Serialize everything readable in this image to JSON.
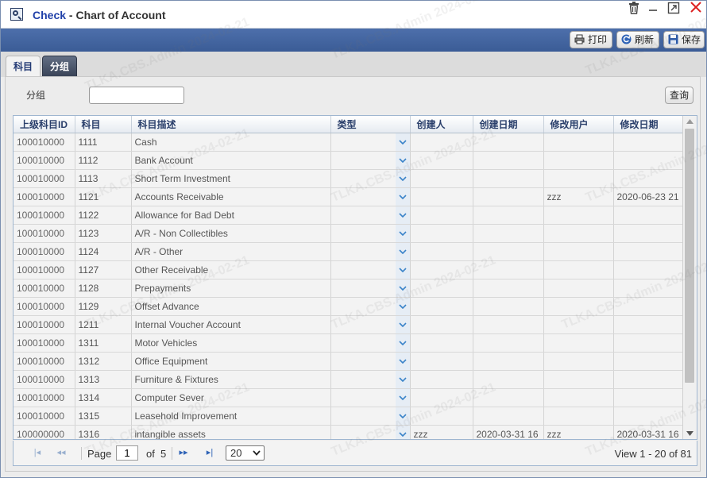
{
  "window": {
    "title_prefix": "Check",
    "title_sep": " - ",
    "title_main": "Chart of Account",
    "buttons": [
      "trash",
      "minimize",
      "maximize",
      "close"
    ]
  },
  "toolbar": {
    "print_label": "打印",
    "refresh_label": "刷新",
    "save_label": "保存"
  },
  "tabs": [
    {
      "label": "科目",
      "active": true
    },
    {
      "label": "分组",
      "active": false
    }
  ],
  "filter": {
    "label": "分组",
    "value": "",
    "query_label": "查询"
  },
  "grid": {
    "columns": [
      "上级科目ID",
      "科目",
      "科目描述",
      "类型",
      "创建人",
      "创建日期",
      "修改用户",
      "修改日期"
    ],
    "rows": [
      [
        "100010000",
        "1111",
        "Cash",
        "",
        "",
        "",
        "",
        ""
      ],
      [
        "100010000",
        "1112",
        "Bank Account",
        "",
        "",
        "",
        "",
        ""
      ],
      [
        "100010000",
        "1113",
        "Short Term Investment",
        "",
        "",
        "",
        "",
        ""
      ],
      [
        "100010000",
        "1121",
        "Accounts Receivable",
        "",
        "",
        "",
        "zzz",
        "2020-06-23 21"
      ],
      [
        "100010000",
        "1122",
        "Allowance for Bad Debt",
        "",
        "",
        "",
        "",
        ""
      ],
      [
        "100010000",
        "1123",
        "A/R - Non Collectibles",
        "",
        "",
        "",
        "",
        ""
      ],
      [
        "100010000",
        "1124",
        "A/R - Other",
        "",
        "",
        "",
        "",
        ""
      ],
      [
        "100010000",
        "1127",
        "Other Receivable",
        "",
        "",
        "",
        "",
        ""
      ],
      [
        "100010000",
        "1128",
        "Prepayments",
        "",
        "",
        "",
        "",
        ""
      ],
      [
        "100010000",
        "1129",
        "Offset Advance",
        "",
        "",
        "",
        "",
        ""
      ],
      [
        "100010000",
        "1211",
        "Internal Voucher Account",
        "",
        "",
        "",
        "",
        ""
      ],
      [
        "100010000",
        "1311",
        "Motor Vehicles",
        "",
        "",
        "",
        "",
        ""
      ],
      [
        "100010000",
        "1312",
        "Office Equipment",
        "",
        "",
        "",
        "",
        ""
      ],
      [
        "100010000",
        "1313",
        "Furniture & Fixtures",
        "",
        "",
        "",
        "",
        ""
      ],
      [
        "100010000",
        "1314",
        "Computer Sever",
        "",
        "",
        "",
        "",
        ""
      ],
      [
        "100010000",
        "1315",
        "Leasehold Improvement",
        "",
        "",
        "",
        "",
        ""
      ],
      [
        "100000000",
        "1316",
        "intangible assets",
        "",
        "zzz",
        "2020-03-31 16",
        "zzz",
        "2020-03-31 16"
      ]
    ]
  },
  "pager": {
    "page_label": "Page",
    "page_value": "1",
    "of_label": "of",
    "total_pages": "5",
    "page_size": "20",
    "view_text": "View  1 - 20  of 81"
  },
  "watermark": "TLKA.CBS.Admin 2024-02-21"
}
